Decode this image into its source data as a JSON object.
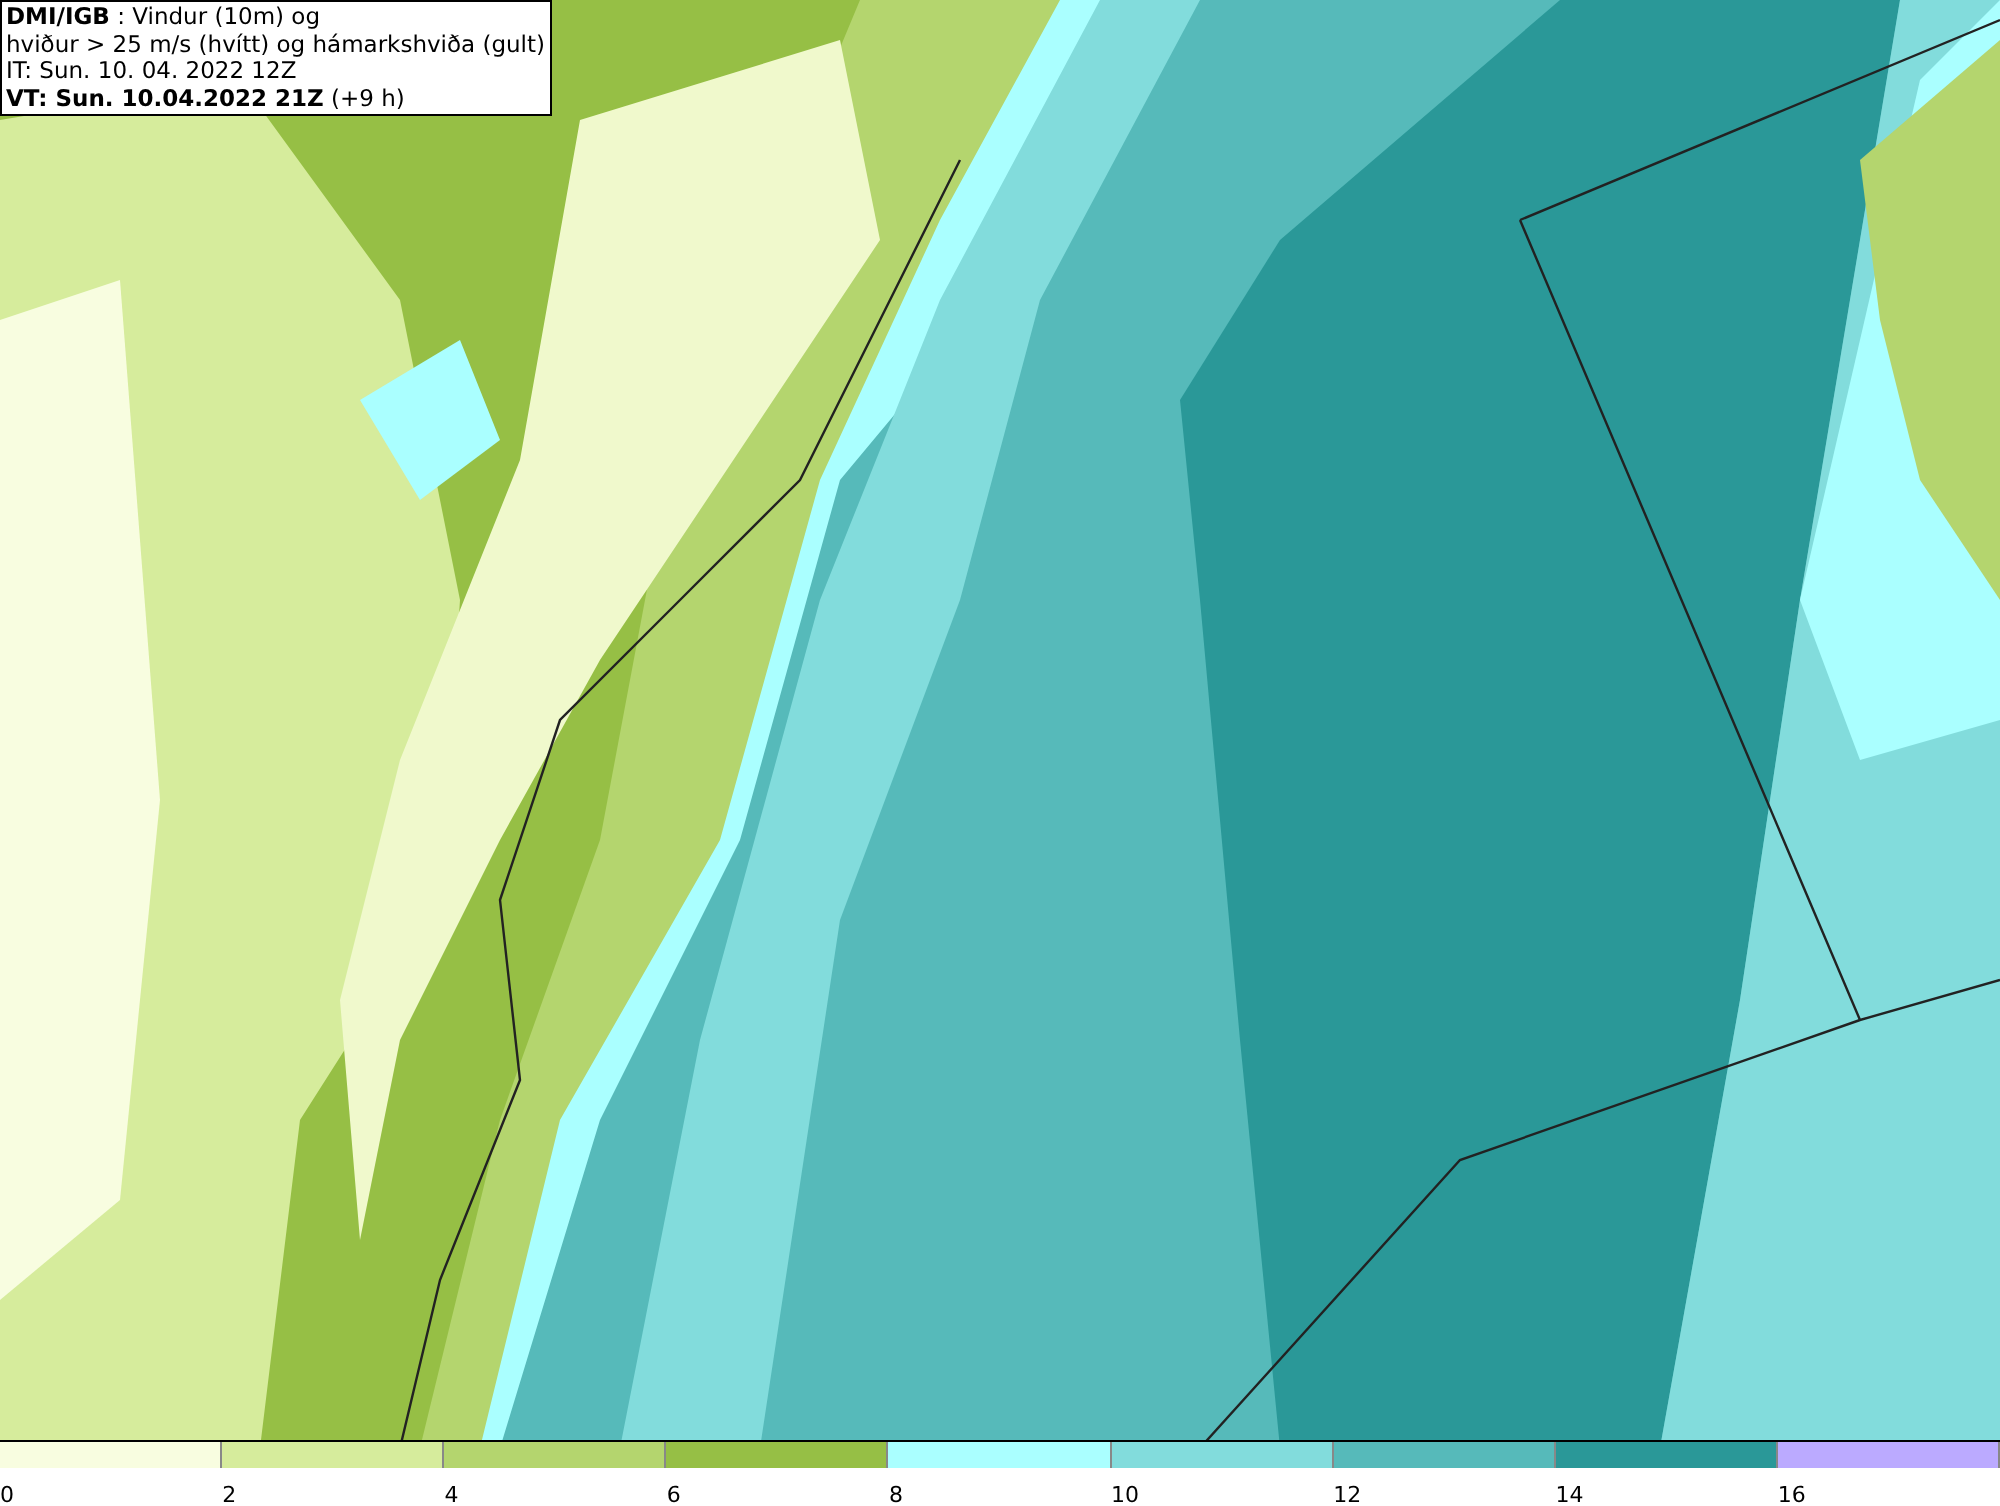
{
  "header": {
    "lines": [
      "**DMI/IGB** : Vindur (10m) og",
      "hviður > 25 m/s (hvítt) og hámarkshviða (gult)",
      "IT: Sun. 10. 04. 2022 12Z",
      "**VT: Sun. 10.04.2022 21Z** (+9 h)"
    ]
  },
  "legend": [
    {
      "color": "#f8fde0",
      "label": "0"
    },
    {
      "color": "#d6ec9c",
      "label": "2"
    },
    {
      "color": "#b4d56e",
      "label": "4"
    },
    {
      "color": "#96bf45",
      "label": "6"
    },
    {
      "color": "#aaffff",
      "label": "8"
    },
    {
      "color": "#82dcdc",
      "label": "10"
    },
    {
      "color": "#56baba",
      "label": "12"
    },
    {
      "color": "#2a9898",
      "label": "14"
    },
    {
      "color": "#bbaaff",
      "label": "16"
    }
  ]
}
